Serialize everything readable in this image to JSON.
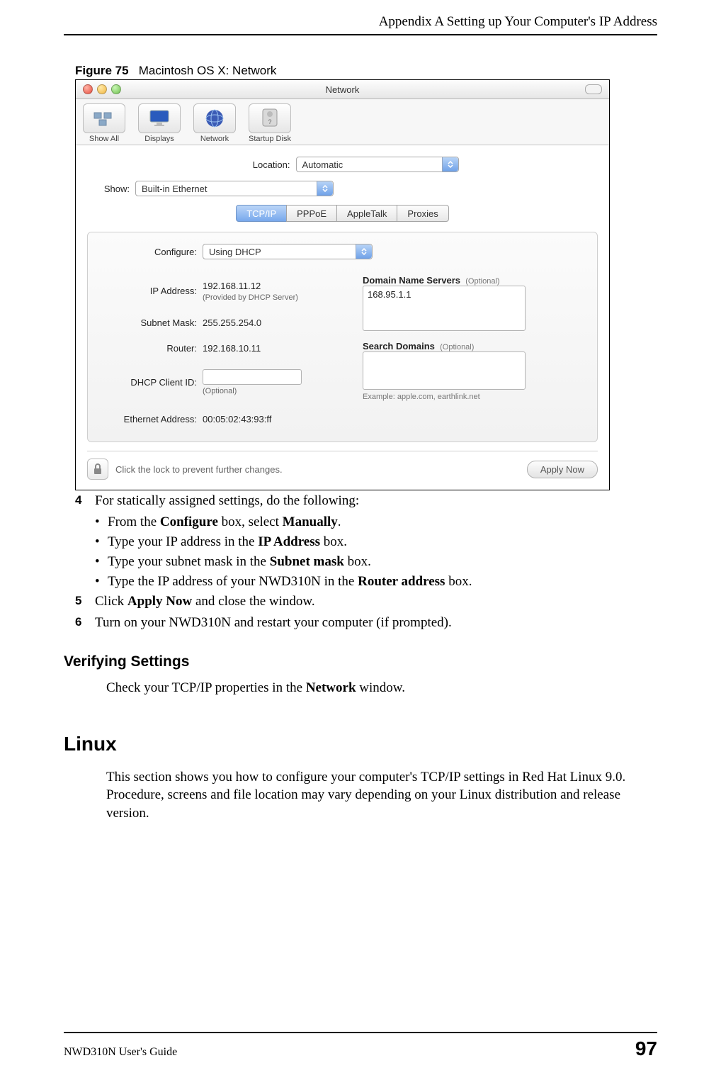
{
  "header": {
    "chapter_title": "Appendix A Setting up Your Computer's IP Address"
  },
  "figure": {
    "label": "Figure 75",
    "caption": "Macintosh OS X: Network"
  },
  "mac": {
    "window_title": "Network",
    "toolbar": {
      "show_all": "Show All",
      "displays": "Displays",
      "network": "Network",
      "startup_disk": "Startup Disk"
    },
    "location": {
      "label": "Location:",
      "value": "Automatic"
    },
    "show": {
      "label": "Show:",
      "value": "Built-in Ethernet"
    },
    "tabs": {
      "tcpip": "TCP/IP",
      "pppoe": "PPPoE",
      "appletalk": "AppleTalk",
      "proxies": "Proxies"
    },
    "configure": {
      "label": "Configure:",
      "value": "Using DHCP"
    },
    "ip": {
      "label": "IP Address:",
      "value": "192.168.11.12",
      "note": "(Provided by DHCP Server)"
    },
    "subnet": {
      "label": "Subnet Mask:",
      "value": "255.255.254.0"
    },
    "router": {
      "label": "Router:",
      "value": "192.168.10.11"
    },
    "dhcpid": {
      "label": "DHCP Client ID:",
      "value": "",
      "note": "(Optional)"
    },
    "ethaddr": {
      "label": "Ethernet Address:",
      "value": "00:05:02:43:93:ff"
    },
    "dns": {
      "label": "Domain Name Servers",
      "note": "(Optional)",
      "value": "168.95.1.1"
    },
    "search": {
      "label": "Search Domains",
      "note": "(Optional)",
      "value": "",
      "example": "Example: apple.com, earthlink.net"
    },
    "lock_text": "Click the lock to prevent further changes.",
    "apply_btn": "Apply Now"
  },
  "steps": {
    "s4": {
      "num": "4",
      "text": "For statically assigned settings, do the following:",
      "bullets": {
        "b1_pre": "From the ",
        "b1_bold1": "Configure",
        "b1_mid": " box, select ",
        "b1_bold2": "Manually",
        "b1_post": ".",
        "b2_pre": "Type your IP address in the ",
        "b2_bold": "IP Address",
        "b2_post": " box.",
        "b3_pre": "Type your subnet mask in the ",
        "b3_bold": "Subnet mask",
        "b3_post": " box.",
        "b4_pre": "Type the IP address of your NWD310N in the ",
        "b4_bold": "Router address",
        "b4_post": " box."
      }
    },
    "s5": {
      "num": "5",
      "pre": "Click ",
      "bold": "Apply Now",
      "post": " and close the window."
    },
    "s6": {
      "num": "6",
      "text": "Turn on your NWD310N and restart your computer (if prompted)."
    }
  },
  "sections": {
    "verifying_heading": "Verifying Settings",
    "verifying_text_pre": "Check your TCP/IP properties in the ",
    "verifying_text_bold": "Network",
    "verifying_text_post": " window.",
    "linux_heading": "Linux",
    "linux_text": "This section shows you how to configure your computer's TCP/IP settings in Red Hat Linux 9.0. Procedure, screens and file location may vary depending on your Linux distribution and release version."
  },
  "footer": {
    "guide": "NWD310N User's Guide",
    "page": "97"
  }
}
